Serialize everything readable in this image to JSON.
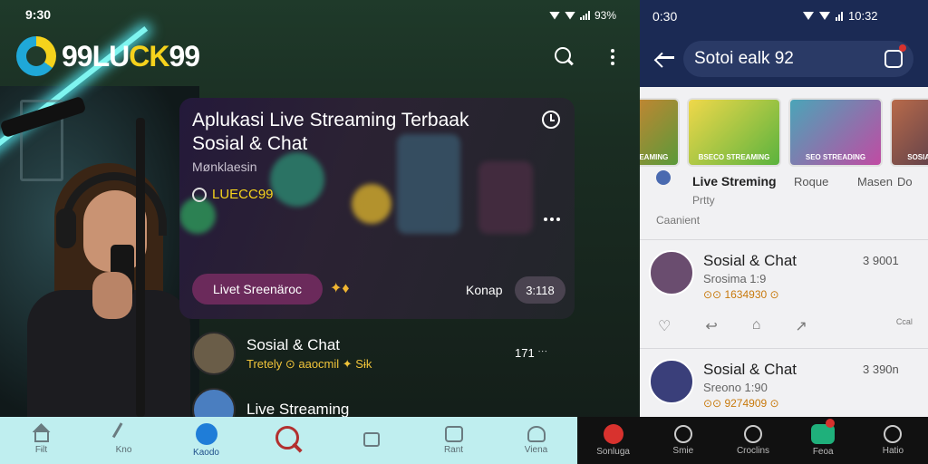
{
  "left": {
    "status": {
      "time": "9:30",
      "battery": "93%"
    },
    "logo": {
      "text_a": "99LU",
      "text_b": "CK",
      "text_c": "99"
    },
    "featured": {
      "title": "Aplukasi Live Streaming Terbaak Sosial & Chat",
      "subtitle": "Mønklaesin",
      "brand": "LUECC99",
      "button_label": "Livet Sreenäroc",
      "hot_label": "Konap",
      "time_label": "3:118"
    },
    "rows": [
      {
        "title": "Sosial & Chat",
        "meta": "Tretely ⊙ aaocmil ✦ Sɨk",
        "value": "171 ˑˑˑ"
      },
      {
        "title": "Live Streaming",
        "meta": "",
        "value": ""
      }
    ],
    "nav": [
      {
        "label": "Fɨlt",
        "icon": "home-icon"
      },
      {
        "label": "Kno",
        "icon": "broom-icon"
      },
      {
        "label": "Kaodo",
        "icon": "people-icon"
      },
      {
        "label": "",
        "icon": "search-icon"
      },
      {
        "label": "",
        "icon": "chat-icon"
      },
      {
        "label": "Rant",
        "icon": "box-icon"
      },
      {
        "label": "Viena",
        "icon": "profile-icon"
      }
    ]
  },
  "right": {
    "status": {
      "time": "0:30",
      "clock": "10:32"
    },
    "search_value": "Sotoi ealk 92",
    "thumbs": [
      {
        "caption": "BSECO STREAMING"
      },
      {
        "caption": "SEO STREADING"
      },
      {
        "caption": "SOSIAL RCOHAT"
      },
      {
        "caption": ""
      }
    ],
    "thumb_labels": {
      "main": "Live Streming",
      "second": "Roque",
      "third": "Masen",
      "fourth": "Do"
    },
    "feed_top": {
      "sub": "Prtty",
      "meta": "Caanient"
    },
    "items": [
      {
        "title": "Sosial & Chat",
        "sub": "Srosima 1:9",
        "meta": "⊙⊙ 1634930 ⊙",
        "value": "3 9001"
      },
      {
        "title": "Sosial & Chat",
        "sub": "Sreono 1:90",
        "meta": "⊙⊙ 9274909 ⊙",
        "value": "3 390n"
      }
    ],
    "action_label": "Ccal",
    "nav": [
      {
        "label": "Sonluga",
        "icon": "live-icon"
      },
      {
        "label": "Smie",
        "icon": "search-icon"
      },
      {
        "label": "Croclins",
        "icon": "explore-icon"
      },
      {
        "label": "Feoa",
        "icon": "messages-icon"
      },
      {
        "label": "Hatio",
        "icon": "profile-icon"
      }
    ]
  }
}
